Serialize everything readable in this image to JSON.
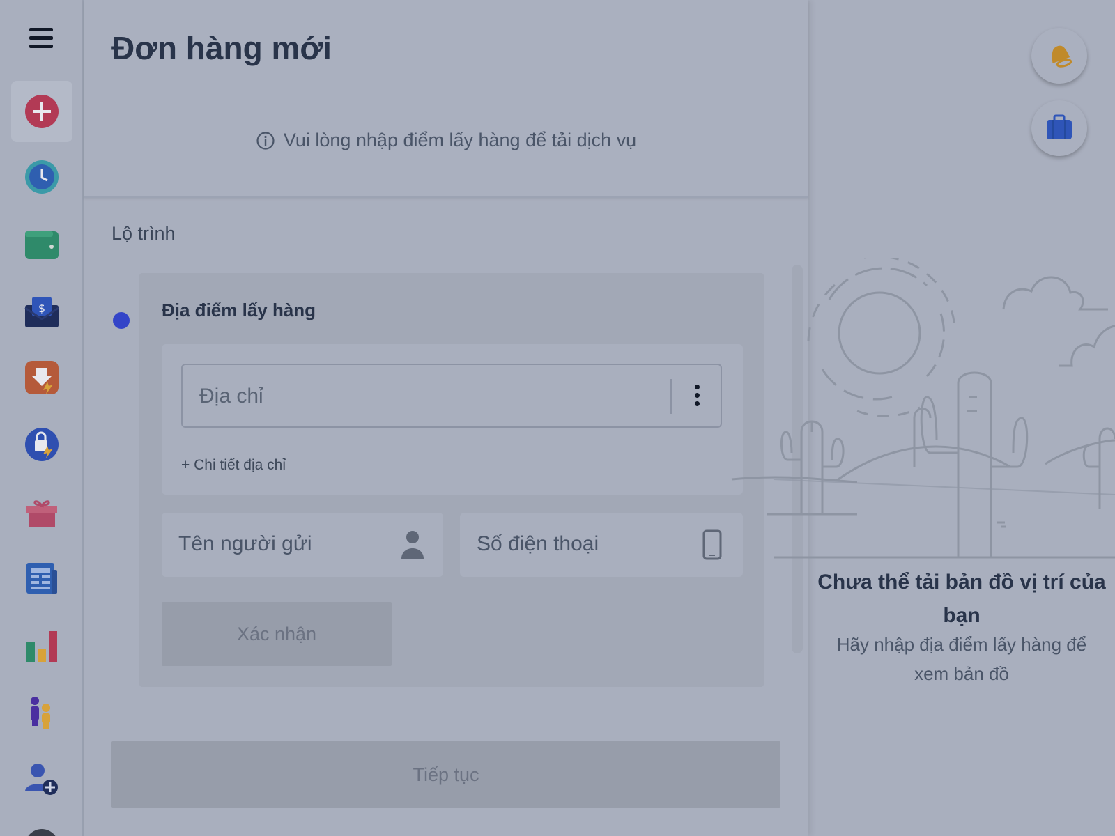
{
  "header": {
    "title": "Đơn hàng mới",
    "info": "Vui lòng nhập điểm lấy hàng để tải dịch vụ"
  },
  "sidebar": {
    "items": [
      {
        "icon": "add-order-icon",
        "active": true
      },
      {
        "icon": "clock-icon"
      },
      {
        "icon": "wallet-icon"
      },
      {
        "icon": "money-envelope-icon"
      },
      {
        "icon": "download-bolt-icon"
      },
      {
        "icon": "lock-bolt-icon"
      },
      {
        "icon": "gift-icon"
      },
      {
        "icon": "news-icon"
      },
      {
        "icon": "bar-chart-icon"
      },
      {
        "icon": "people-icon"
      },
      {
        "icon": "add-user-icon"
      }
    ]
  },
  "route": {
    "section_title": "Lộ trình",
    "pickup_title": "Địa điểm lấy hàng",
    "address_placeholder": "Địa chỉ",
    "address_detail": "+ Chi tiết địa chỉ",
    "sender_name_placeholder": "Tên người gửi",
    "phone_placeholder": "Số điện thoại",
    "confirm_label": "Xác nhận"
  },
  "footer": {
    "continue_label": "Tiếp tục"
  },
  "map": {
    "title": "Chưa thể tải bản đồ vị trí của bạn",
    "subtitle": "Hãy nhập địa điểm lấy hàng để xem bản đồ"
  },
  "colors": {
    "overlay_bg": "#a9afbe",
    "dot": "#3344c8",
    "title": "#29344a"
  }
}
